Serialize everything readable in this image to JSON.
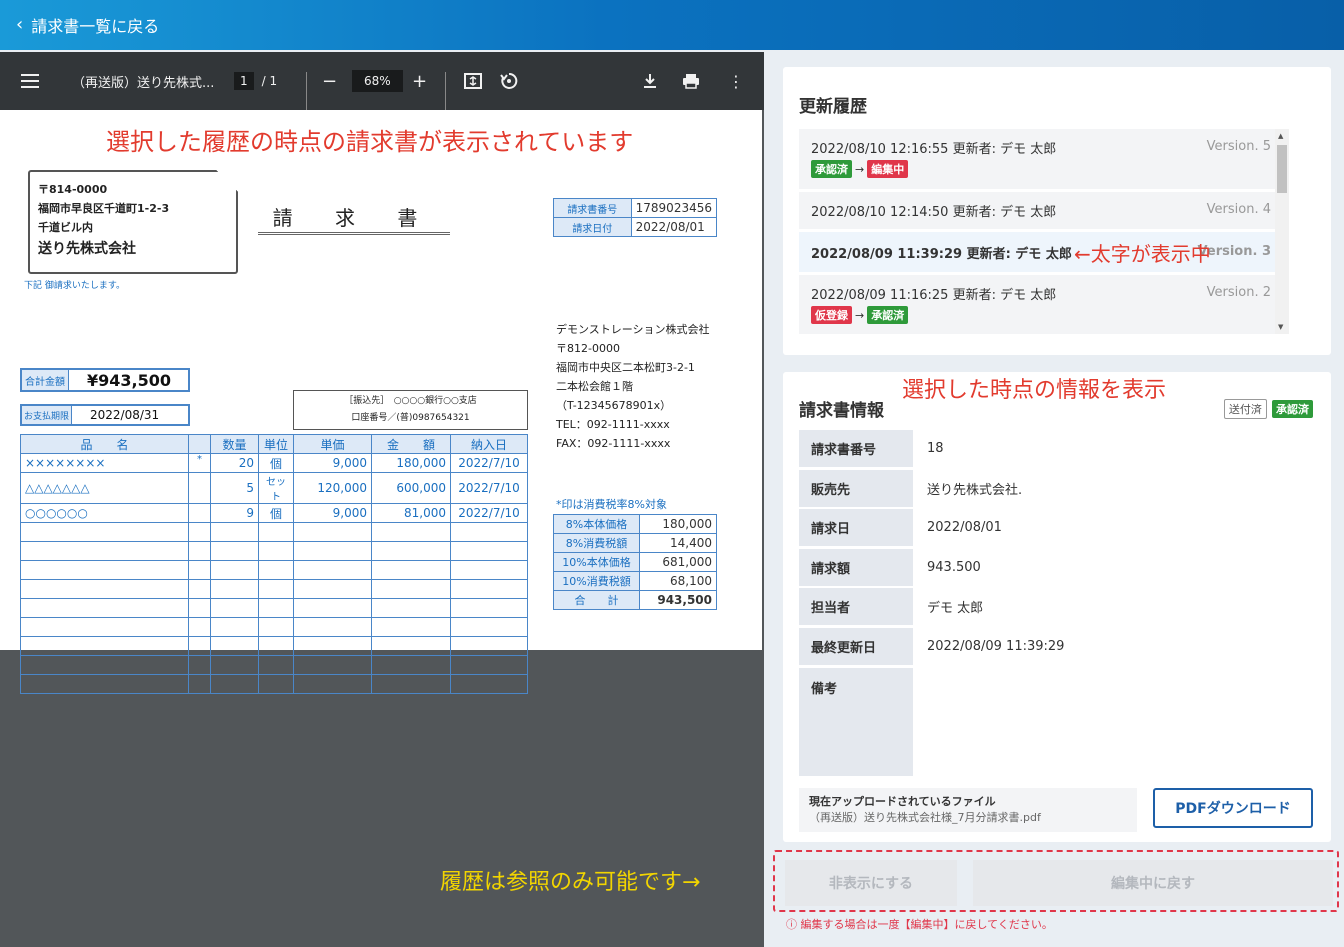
{
  "topbar": {
    "back_label": "請求書一覧に戻る"
  },
  "viewer": {
    "title": "（再送版）送り先株式...",
    "page_current": "1",
    "page_total": "/  1",
    "zoom": "68%"
  },
  "invoice": {
    "note": "選択した履歴の時点の請求書が表示されています",
    "postal": "〒814-0000",
    "address1": "福岡市早良区千道町1-2-3",
    "address2": "千道ビル内",
    "company": "送り先株式会社",
    "request_note": "下記 御請求いたします。",
    "title": "請 求 書",
    "number_label": "請求書番号",
    "number": "1789023456",
    "date_label": "請求日付",
    "date": "2022/08/01",
    "sender": [
      "デモンストレーション株式会社",
      "〒812-0000",
      "福岡市中央区二本松町3-2-1",
      "二本松会館１階",
      "（T-12345678901x）",
      "TEL：092-1111-xxxx",
      "FAX：092-1111-xxxx"
    ],
    "total_label": "合計金額",
    "total": "¥943,500",
    "due_label": "お支払期限",
    "due": "2022/08/31",
    "bank1": "［振込先］　○○○○銀行○○支店",
    "bank2": "口座番号／(普)0987654321",
    "headers": [
      "品　　名",
      "",
      "数量",
      "単位",
      "単価",
      "金　　額",
      "納入日"
    ],
    "rows": [
      [
        "××××××××",
        "*",
        "20",
        "個",
        "9,000",
        "180,000",
        "2022/7/10"
      ],
      [
        "△△△△△△△",
        "",
        "5",
        "セット",
        "120,000",
        "600,000",
        "2022/7/10"
      ],
      [
        "○○○○○○",
        "",
        "9",
        "個",
        "9,000",
        "81,000",
        "2022/7/10"
      ]
    ],
    "tax_note": "*印は消費税率8%対象",
    "tax": [
      [
        "8%本体価格",
        "180,000"
      ],
      [
        "8%消費税額",
        "14,400"
      ],
      [
        "10%本体価格",
        "681,000"
      ],
      [
        "10%消費税額",
        "68,100"
      ],
      [
        "合　　計",
        "943,500"
      ]
    ]
  },
  "history": {
    "title": "更新履歴",
    "items": [
      {
        "text": "2022/08/10  12:16:55   更新者: デモ 太郎",
        "version": "Version. 5",
        "from": "承認済",
        "to": "編集中"
      },
      {
        "text": "2022/08/10  12:14:50   更新者: デモ 太郎",
        "version": "Version. 4"
      },
      {
        "text": "2022/08/09   11:39:29   更新者: デモ 太郎",
        "version": "Version. 3"
      },
      {
        "text": "2022/08/09   11:16:25   更新者: デモ 太郎",
        "version": "Version. 2",
        "from": "仮登録",
        "to": "承認済"
      }
    ],
    "bold_note": "←太字が表示中"
  },
  "info": {
    "note": "選択した時点の情報を表示",
    "title": "請求書情報",
    "badge_sent": "送付済",
    "badge_approved": "承認済",
    "rows": [
      {
        "k": "請求書番号",
        "v": "18"
      },
      {
        "k": "販売先",
        "v": "送り先株式会社."
      },
      {
        "k": "請求日",
        "v": "2022/08/01"
      },
      {
        "k": "請求額",
        "v": " 943.500"
      },
      {
        "k": "担当者",
        "v": "デモ 太郎"
      },
      {
        "k": "最終更新日",
        "v": "2022/08/09 11:39:29"
      },
      {
        "k": "備考",
        "v": ""
      }
    ],
    "file_label": "現在アップロードされているファイル",
    "file_name": "（再送版）送り先株式会社様_7月分請求書.pdf",
    "pdf_button": "PDFダウンロード"
  },
  "actions": {
    "hide": "非表示にする",
    "revert": "編集中に戻す",
    "warning": "ⓘ 編集する場合は一度【編集中】に戻してください。",
    "history_note": "履歴は参照のみ可能です→"
  },
  "colors": {
    "accent": "#0b72c0",
    "approved": "#2e9a3a",
    "editing": "#e0364a",
    "annotation": "#e23b2e",
    "yellow_note": "#f2d500"
  }
}
